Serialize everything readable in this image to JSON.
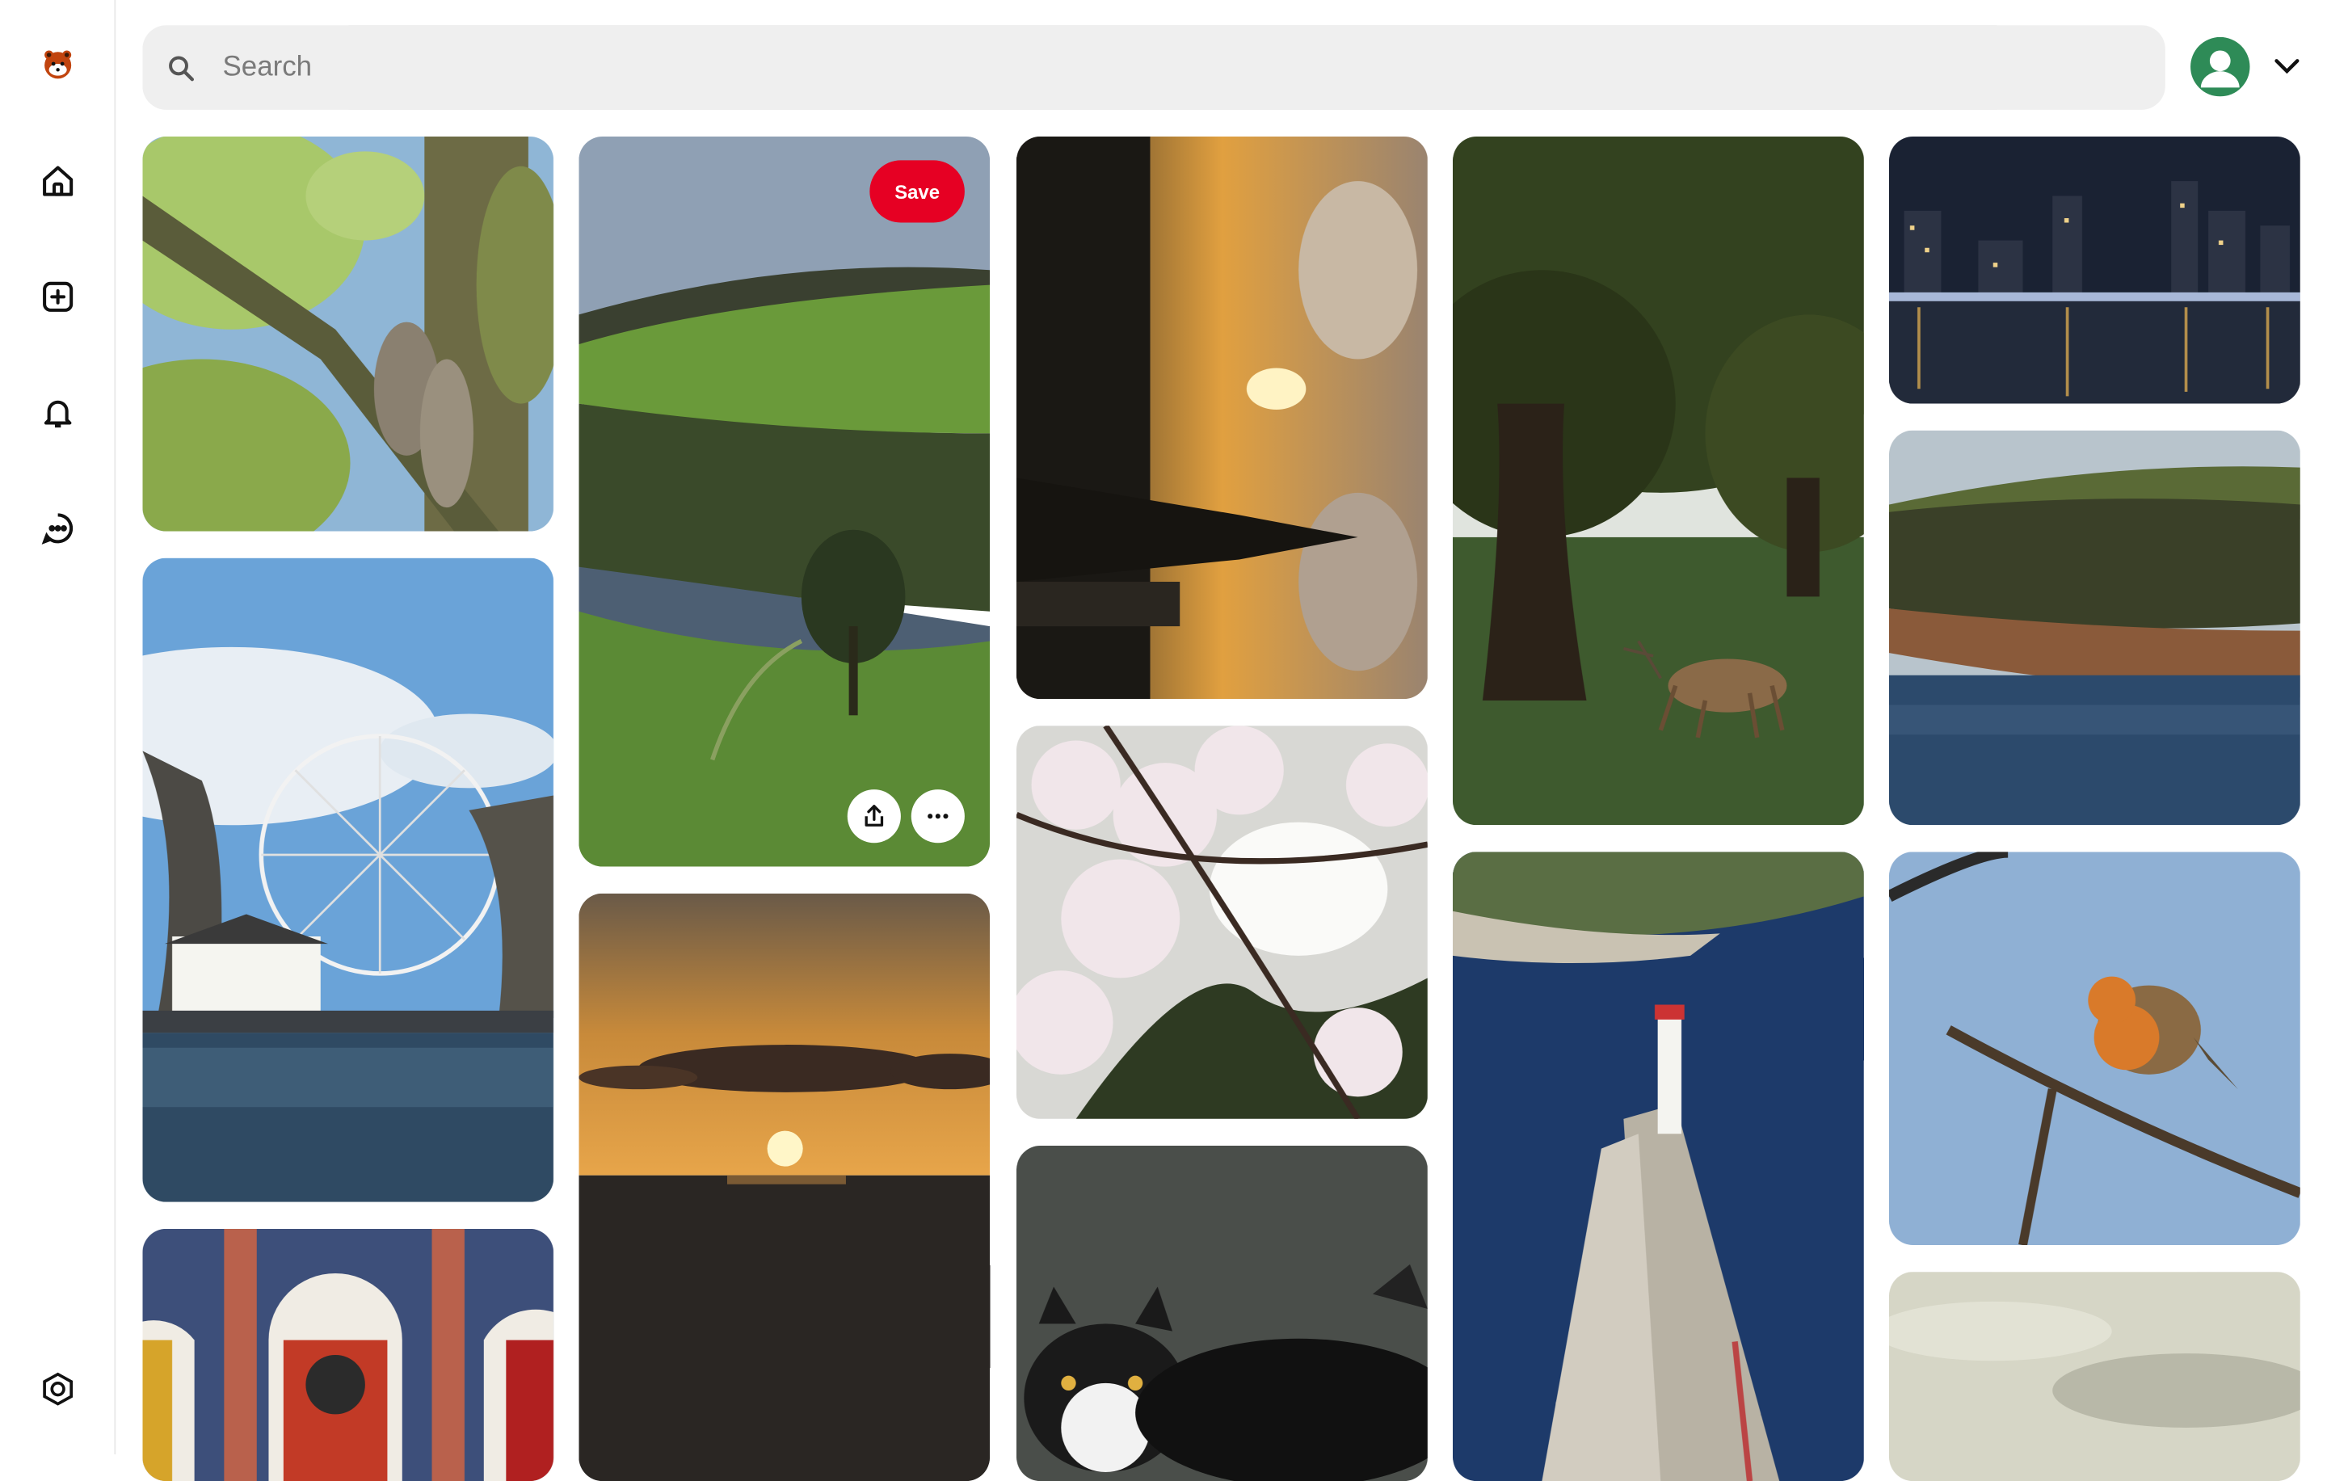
{
  "search": {
    "placeholder": "Search",
    "value": ""
  },
  "sidebar": {
    "items": [
      {
        "icon": "red-panda-logo-icon"
      },
      {
        "icon": "home-icon"
      },
      {
        "icon": "create-plus-icon"
      },
      {
        "icon": "notifications-bell-icon"
      },
      {
        "icon": "messages-chat-icon"
      },
      {
        "icon": "settings-hexagon-icon"
      }
    ]
  },
  "pin_actions": {
    "save_label": "Save"
  },
  "colors": {
    "accent": "#e60023",
    "search_bg": "#efefef",
    "avatar": "#2e8b57"
  },
  "pins": [
    {
      "id": "squirrel-tree"
    },
    {
      "id": "green-hills-river"
    },
    {
      "id": "sunset-tower-silhouette"
    },
    {
      "id": "deer-under-tree"
    },
    {
      "id": "city-night-river"
    },
    {
      "id": "ferris-wheel-lake"
    },
    {
      "id": "sea-sunset"
    },
    {
      "id": "cherry-blossom"
    },
    {
      "id": "lighthouse-pier"
    },
    {
      "id": "cliff-coast-river"
    },
    {
      "id": "doors-arches"
    },
    {
      "id": "black-white-cat"
    },
    {
      "id": "robin-on-branch"
    },
    {
      "id": "cloudy-sky"
    }
  ]
}
